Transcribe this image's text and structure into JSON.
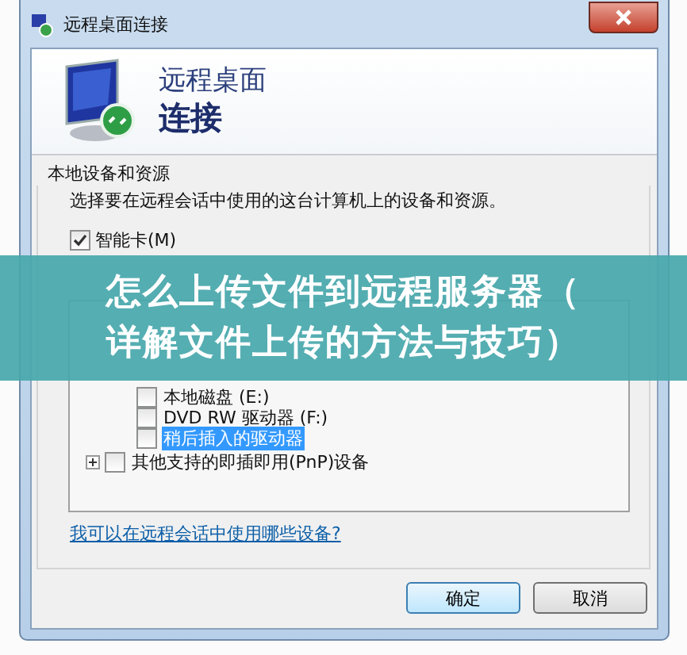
{
  "window": {
    "title": "远程桌面连接"
  },
  "header": {
    "line_1": "远程桌面",
    "line_2": "连接"
  },
  "group": {
    "title": "本地设备和资源",
    "description": "选择要在远程会话中使用的这台计算机上的设备和资源。",
    "checkboxes": [
      {
        "label": "智能卡(M)",
        "checked": true
      }
    ],
    "tree": [
      {
        "children": [
          {
            "label": "本地磁盘 (E:)",
            "checked": false,
            "selected": false
          },
          {
            "label": "DVD RW 驱动器 (F:)",
            "checked": false,
            "selected": false
          },
          {
            "label": "稍后插入的驱动器",
            "checked": false,
            "selected": true
          }
        ]
      },
      {
        "label": "其他支持的即插即用(PnP)设备",
        "checked": false,
        "selected": false,
        "expanded": false
      }
    ],
    "link": "我可以在远程会话中使用哪些设备?"
  },
  "buttons": [
    {
      "label": "确定",
      "default": true
    },
    {
      "label": "取消",
      "default": false
    }
  ],
  "banner": {
    "lines": [
      "怎么上传文件到远程服务器（",
      "详解文件上传的方法与技巧）"
    ]
  }
}
